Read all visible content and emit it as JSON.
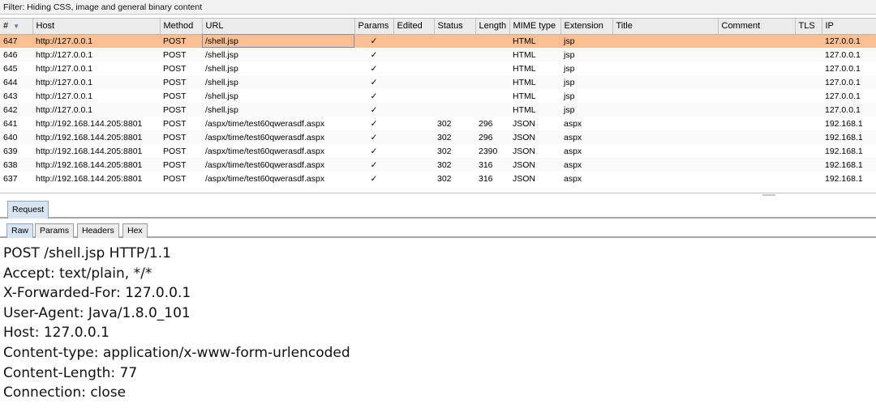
{
  "filter": {
    "text": "Filter: Hiding CSS, image and general binary content"
  },
  "table": {
    "columns": [
      "#",
      "Host",
      "Method",
      "URL",
      "Params",
      "Edited",
      "Status",
      "Length",
      "MIME type",
      "Extension",
      "Title",
      "Comment",
      "TLS",
      "IP"
    ],
    "sort_indicator": "▼",
    "selected_row": "647",
    "rows": [
      {
        "id": "647",
        "host": "http://127.0.0.1",
        "method": "POST",
        "url": "/shell.jsp",
        "params": "✓",
        "edited": "",
        "status": "",
        "length": "",
        "mime": "HTML",
        "ext": "jsp",
        "title": "",
        "comment": "",
        "tls": "",
        "ip": "127.0.0.1"
      },
      {
        "id": "646",
        "host": "http://127.0.0.1",
        "method": "POST",
        "url": "/shell.jsp",
        "params": "✓",
        "edited": "",
        "status": "",
        "length": "",
        "mime": "HTML",
        "ext": "jsp",
        "title": "",
        "comment": "",
        "tls": "",
        "ip": "127.0.0.1"
      },
      {
        "id": "645",
        "host": "http://127.0.0.1",
        "method": "POST",
        "url": "/shell.jsp",
        "params": "✓",
        "edited": "",
        "status": "",
        "length": "",
        "mime": "HTML",
        "ext": "jsp",
        "title": "",
        "comment": "",
        "tls": "",
        "ip": "127.0.0.1"
      },
      {
        "id": "644",
        "host": "http://127.0.0.1",
        "method": "POST",
        "url": "/shell.jsp",
        "params": "✓",
        "edited": "",
        "status": "",
        "length": "",
        "mime": "HTML",
        "ext": "jsp",
        "title": "",
        "comment": "",
        "tls": "",
        "ip": "127.0.0.1"
      },
      {
        "id": "643",
        "host": "http://127.0.0.1",
        "method": "POST",
        "url": "/shell.jsp",
        "params": "✓",
        "edited": "",
        "status": "",
        "length": "",
        "mime": "HTML",
        "ext": "jsp",
        "title": "",
        "comment": "",
        "tls": "",
        "ip": "127.0.0.1"
      },
      {
        "id": "642",
        "host": "http://127.0.0.1",
        "method": "POST",
        "url": "/shell.jsp",
        "params": "✓",
        "edited": "",
        "status": "",
        "length": "",
        "mime": "HTML",
        "ext": "jsp",
        "title": "",
        "comment": "",
        "tls": "",
        "ip": "127.0.0.1"
      },
      {
        "id": "641",
        "host": "http://192.168.144.205:8801",
        "method": "POST",
        "url": "/aspx/time/test60qwerasdf.aspx",
        "params": "✓",
        "edited": "",
        "status": "302",
        "length": "296",
        "mime": "JSON",
        "ext": "aspx",
        "title": "",
        "comment": "",
        "tls": "",
        "ip": "192.168.1"
      },
      {
        "id": "640",
        "host": "http://192.168.144.205:8801",
        "method": "POST",
        "url": "/aspx/time/test60qwerasdf.aspx",
        "params": "✓",
        "edited": "",
        "status": "302",
        "length": "296",
        "mime": "JSON",
        "ext": "aspx",
        "title": "",
        "comment": "",
        "tls": "",
        "ip": "192.168.1"
      },
      {
        "id": "639",
        "host": "http://192.168.144.205:8801",
        "method": "POST",
        "url": "/aspx/time/test60qwerasdf.aspx",
        "params": "✓",
        "edited": "",
        "status": "302",
        "length": "2390",
        "mime": "JSON",
        "ext": "aspx",
        "title": "",
        "comment": "",
        "tls": "",
        "ip": "192.168.1"
      },
      {
        "id": "638",
        "host": "http://192.168.144.205:8801",
        "method": "POST",
        "url": "/aspx/time/test60qwerasdf.aspx",
        "params": "✓",
        "edited": "",
        "status": "302",
        "length": "316",
        "mime": "JSON",
        "ext": "aspx",
        "title": "",
        "comment": "",
        "tls": "",
        "ip": "192.168.1"
      },
      {
        "id": "637",
        "host": "http://192.168.144.205:8801",
        "method": "POST",
        "url": "/aspx/time/test60qwerasdf.aspx",
        "params": "✓",
        "edited": "",
        "status": "302",
        "length": "316",
        "mime": "JSON",
        "ext": "aspx",
        "title": "",
        "comment": "",
        "tls": "",
        "ip": "192.168.1"
      }
    ]
  },
  "tabs": {
    "request": "Request"
  },
  "subtabs": [
    "Raw",
    "Params",
    "Headers",
    "Hex"
  ],
  "request_lines": [
    "POST /shell.jsp HTTP/1.1",
    "Accept: text/plain, */*",
    "X-Forwarded-For: 127.0.0.1",
    "User-Agent: Java/1.8.0_101",
    "Host: 127.0.0.1",
    "Content-type: application/x-www-form-urlencoded",
    "Content-Length: 77",
    "Connection: close"
  ],
  "colors": {
    "selected_row": "#fbbf91",
    "active_tab": "#d8e4f0",
    "header_bg": "#ececec"
  }
}
